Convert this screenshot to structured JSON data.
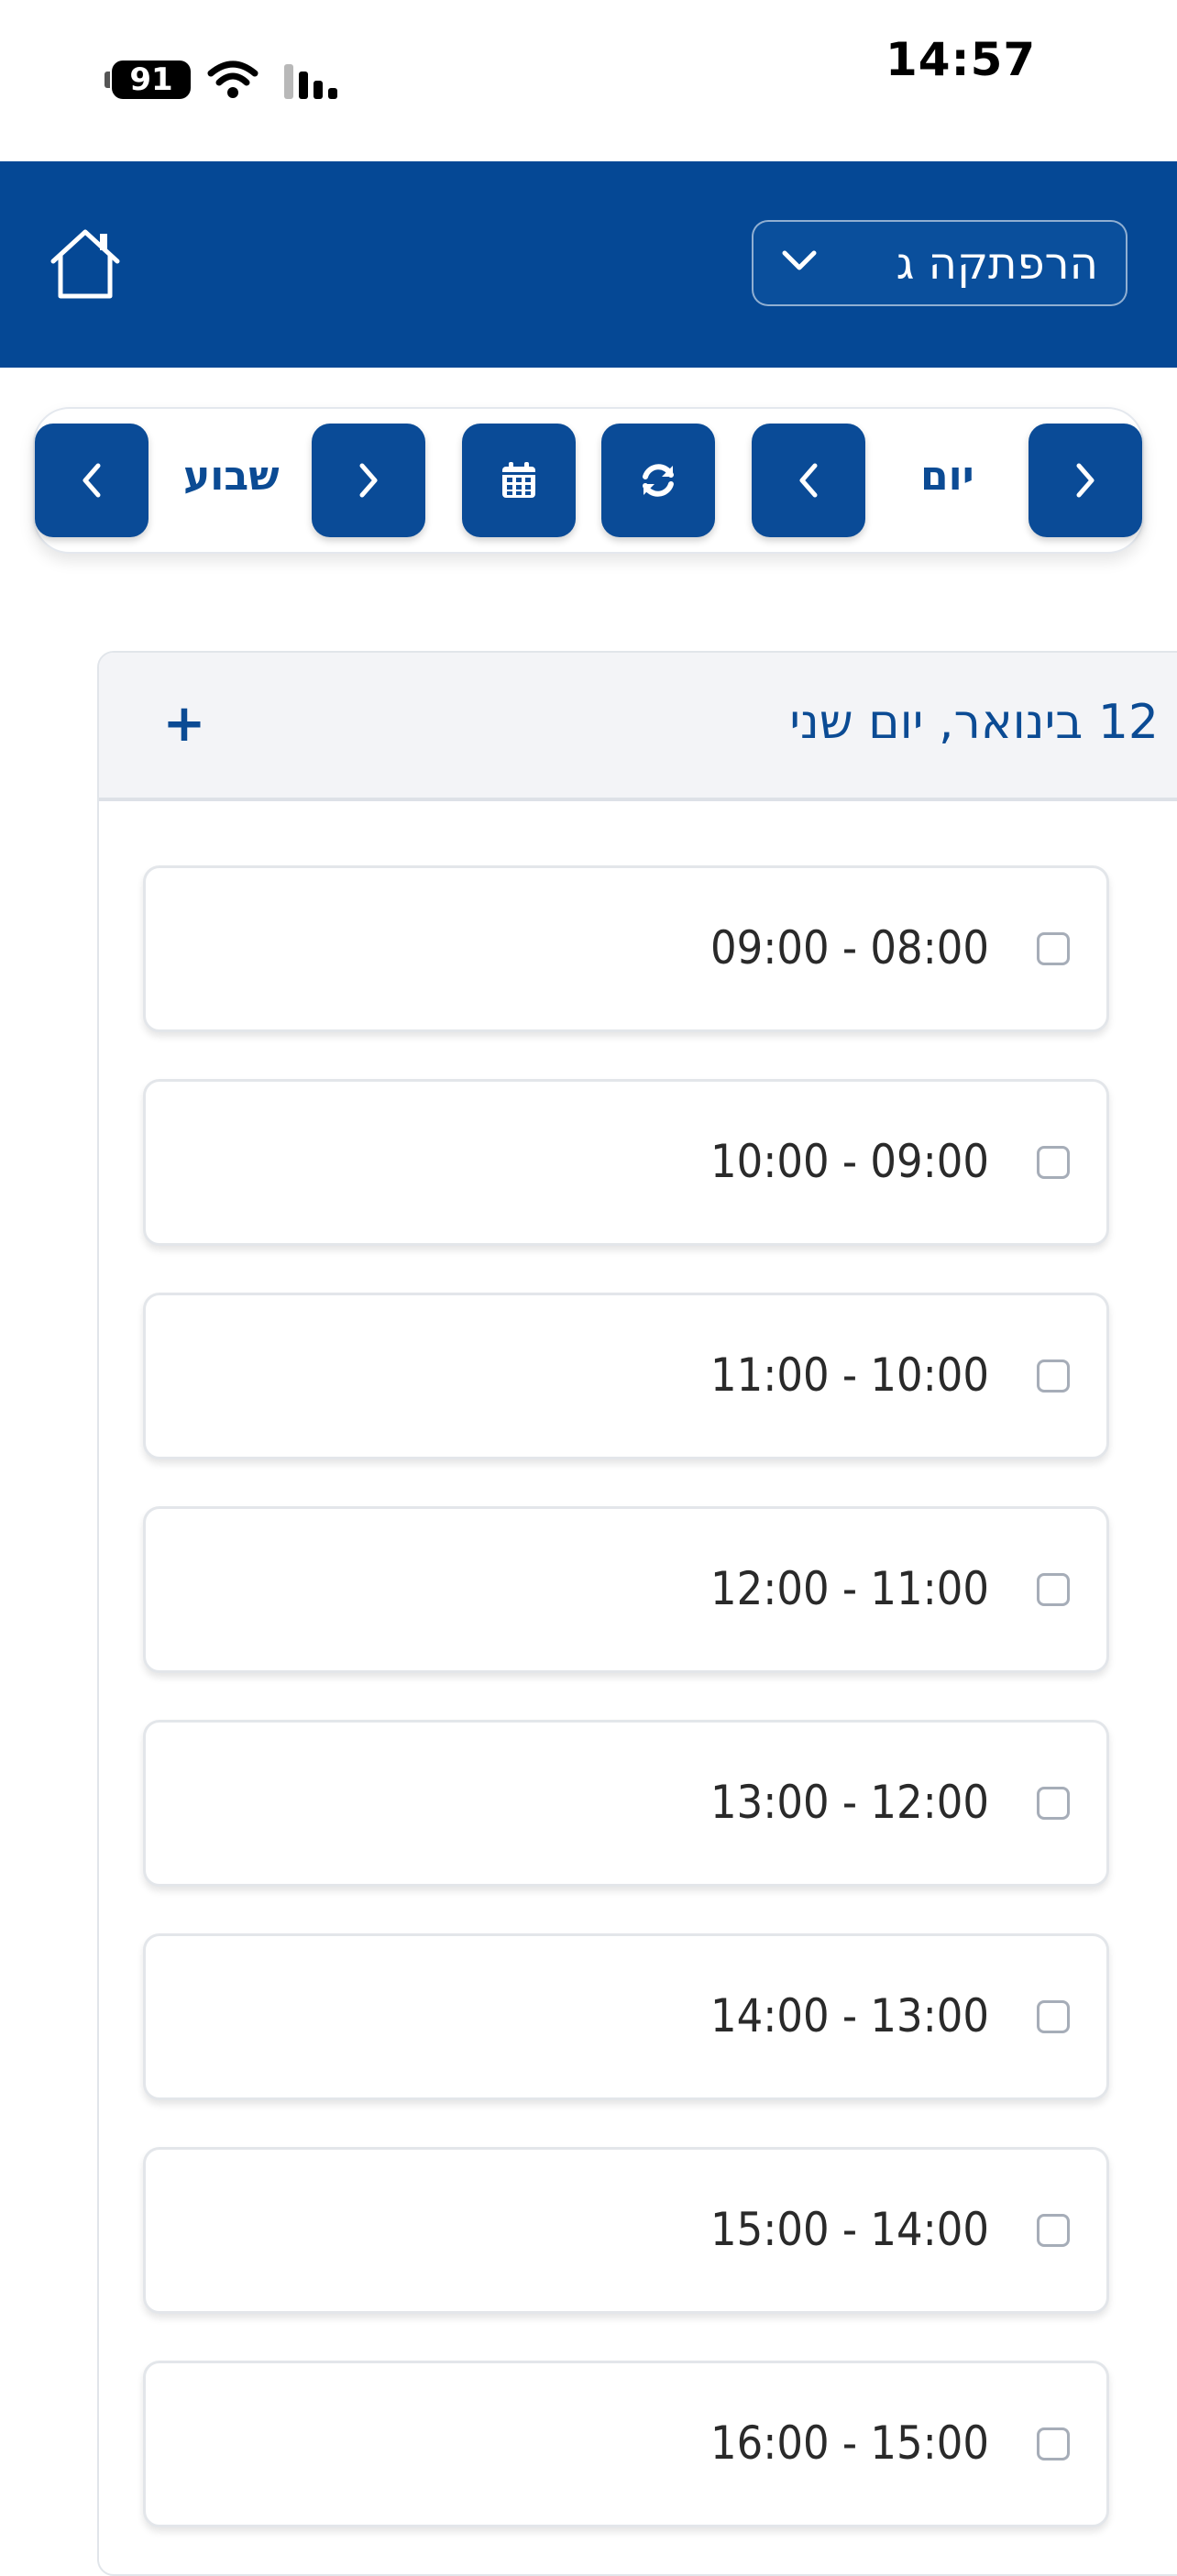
{
  "status_bar": {
    "battery": "91",
    "time": "14:57"
  },
  "header": {
    "selected_option": "הרפתקה ג",
    "colors": {
      "background": "#054895",
      "text": "#ffffff"
    }
  },
  "toolbar": {
    "day_label": "יום",
    "week_label": "שבוע"
  },
  "day_card": {
    "title": "12 בינואר, יום שני",
    "add_label": "+",
    "slots": [
      {
        "time": "09:00 - 08:00",
        "checked": false
      },
      {
        "time": "10:00 - 09:00",
        "checked": false
      },
      {
        "time": "11:00 - 10:00",
        "checked": false
      },
      {
        "time": "12:00 - 11:00",
        "checked": false
      },
      {
        "time": "13:00 - 12:00",
        "checked": false
      },
      {
        "time": "14:00 - 13:00",
        "checked": false
      },
      {
        "time": "15:00 - 14:00",
        "checked": false
      },
      {
        "time": "16:00 - 15:00",
        "checked": false
      }
    ]
  },
  "accent_color": "#0a4b97"
}
